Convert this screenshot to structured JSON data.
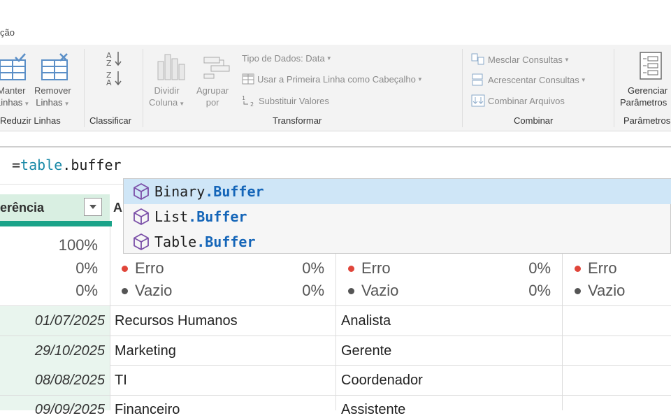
{
  "tab": {
    "partial_label": "ção"
  },
  "ribbon": {
    "groups": {
      "reduzir_linhas": {
        "label": "Reduzir Linhas",
        "manter_l1": "Manter",
        "manter_l2": "Linhas",
        "remover_l1": "Remover",
        "remover_l2": "Linhas"
      },
      "classificar": {
        "label": "Classificar"
      },
      "transformar": {
        "label": "Transformar",
        "dividir_l1": "Dividir",
        "dividir_l2": "Coluna",
        "agrupar_l1": "Agrupar",
        "agrupar_l2": "por",
        "tipo_dados": "Tipo de Dados: Data",
        "primeira_linha": "Usar a Primeira Linha como Cabeçalho",
        "substituir": "Substituir Valores"
      },
      "combinar": {
        "label": "Combinar",
        "mesclar": "Mesclar Consultas",
        "acrescentar": "Acrescentar Consultas",
        "combinar_arquivos": "Combinar Arquivos"
      },
      "parametros": {
        "label": "Parâmetros",
        "gerenciar_l1": "Gerenciar",
        "gerenciar_l2": "Parâmetros"
      }
    }
  },
  "formula": {
    "prefix": "=",
    "fn_ns": "table",
    "fn_sep": ".",
    "fn_name": "buffer"
  },
  "suggestions": [
    {
      "ns": "Binary",
      "sep": ".",
      "name": "Buffer",
      "selected": true
    },
    {
      "ns": "List",
      "sep": ".",
      "name": "Buffer",
      "selected": false
    },
    {
      "ns": "Table",
      "sep": ".",
      "name": "Buffer",
      "selected": false
    }
  ],
  "columns": {
    "col1_header": "erência",
    "col2_header_partial": "A"
  },
  "quality": {
    "col1": {
      "valid": "100%",
      "error": "0%",
      "empty": "0%"
    },
    "col2": {
      "error_label": "Erro",
      "error_pct": "0%",
      "empty_label": "Vazio",
      "empty_pct": "0%"
    },
    "col3": {
      "error_label": "Erro",
      "error_pct": "0%",
      "empty_label": "Vazio",
      "empty_pct": "0%"
    },
    "col4": {
      "error_label": "Erro",
      "empty_label": "Vazio"
    },
    "error_color": "#e0453a",
    "empty_color": "#555555"
  },
  "rows": [
    {
      "date": "01/07/2025",
      "dept": "Recursos Humanos",
      "role": "Analista"
    },
    {
      "date": "29/10/2025",
      "dept": "Marketing",
      "role": "Gerente"
    },
    {
      "date": "08/08/2025",
      "dept": "TI",
      "role": "Coordenador"
    },
    {
      "date": "09/09/2025",
      "dept": "Financeiro",
      "role": "Assistente"
    }
  ],
  "colors": {
    "accent": "#1aa389",
    "header_bg": "#d9efe2",
    "suggest_selected": "#cfe6f7",
    "match_blue": "#1465b8",
    "keyword_teal": "#1a8aa8"
  }
}
